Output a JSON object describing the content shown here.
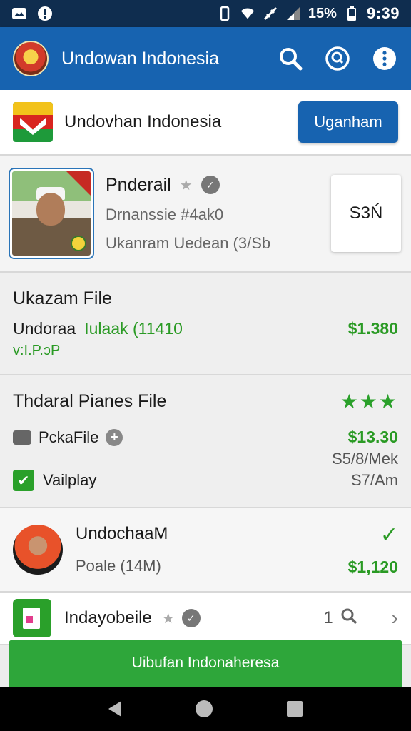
{
  "status_bar": {
    "battery": "15%",
    "time": "9:39"
  },
  "app_bar": {
    "title": "Undowan Indonesia",
    "icons": [
      "search-icon",
      "chat-search-icon",
      "more-vert-icon"
    ]
  },
  "header": {
    "title": "Undovhan Indonesia",
    "button_label": "Uganham"
  },
  "profile": {
    "name": "Pnderail",
    "line1": "Drnanssie #4ak0",
    "line2": "Ukanram Uedean (3/Sb",
    "code": "S3Ń"
  },
  "file": {
    "title": "Ukazam File",
    "name": "Undoraa",
    "name_green": "Iulaak (11410",
    "price": "$1.380",
    "foot": "v:I.P.ɔP"
  },
  "plan": {
    "title": "Thdaral Pianes File",
    "stars": "★★★",
    "option": "PckaFile",
    "price": "$13.30",
    "sub1": "S5/8/Mek",
    "check_label": "Vailplay",
    "sub2": "S7/Am"
  },
  "user": {
    "name": "UndochaaM",
    "sub": "Poale (14M)",
    "price": "$1,120"
  },
  "mobile": {
    "title": "Indayobeile",
    "count": "1"
  },
  "bottom_button": "Uibufan Indonaheresa",
  "colors": {
    "app_bar": "#1763b0",
    "status_bar": "#0f2d4f",
    "accent_green": "#2aa02a"
  }
}
